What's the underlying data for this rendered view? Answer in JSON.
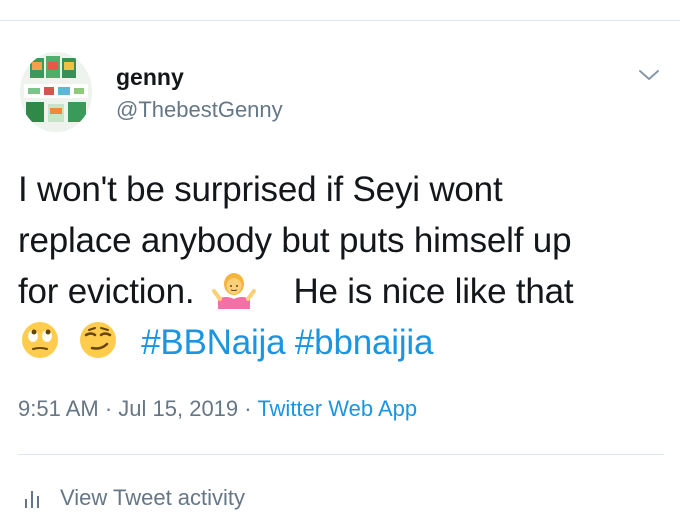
{
  "header": {
    "display_name": "genny",
    "handle": "@ThebestGenny"
  },
  "tweet": {
    "line1": "I won't be surprised if Seyi wont",
    "line2": "replace anybody but puts himself up",
    "line3_before_emoji": "for eviction.",
    "line3_after_emoji": "He is nice like that",
    "hashtag1": "#BBNaija",
    "hashtag2": "#bbnaijia",
    "emojis": [
      "person-shrugging-emoji",
      "face-with-rolling-eyes-emoji",
      "smirking-face-emoji"
    ]
  },
  "meta": {
    "time": "9:51 AM",
    "separator": " · ",
    "date": "Jul 15, 2019",
    "source": "Twitter Web App"
  },
  "footer": {
    "activity_label": "View Tweet activity"
  },
  "colors": {
    "text": "#14171a",
    "secondary": "#657786",
    "link": "#1b95e0",
    "divider": "#e1e8ed"
  }
}
